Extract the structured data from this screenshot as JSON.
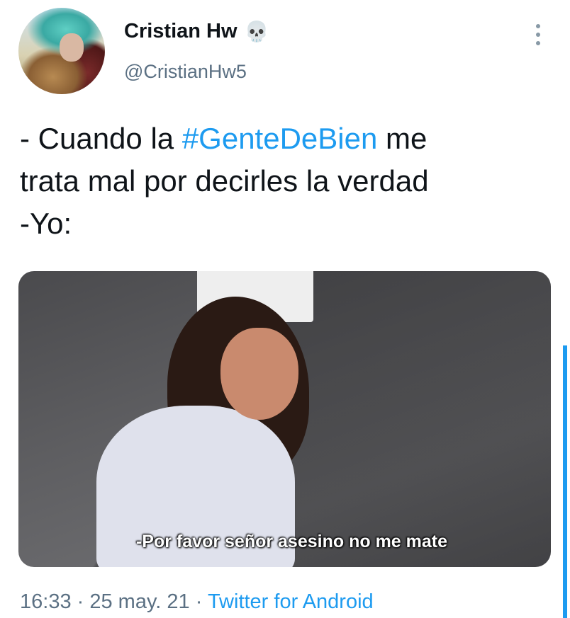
{
  "author": {
    "name": "Cristian Hw",
    "badge_emoji": "💀",
    "handle": "@CristianHw5"
  },
  "tweet": {
    "text_before": "- Cuando la ",
    "hashtag": "#GenteDeBien",
    "text_after_line1": " me",
    "line2": "trata mal por decirles la verdad",
    "line3": "-Yo:"
  },
  "media": {
    "caption": "-Por favor señor asesino no me mate"
  },
  "meta": {
    "time": "16:33",
    "sep1": " · ",
    "date": "25 may. 21",
    "sep2": " · ",
    "source": "Twitter for Android"
  },
  "icons": {
    "more": "more-vertical-icon",
    "badge": "skull-icon"
  },
  "colors": {
    "link": "#1d9bf0",
    "secondary_text": "#5b7083",
    "primary_text": "#0f1419"
  }
}
